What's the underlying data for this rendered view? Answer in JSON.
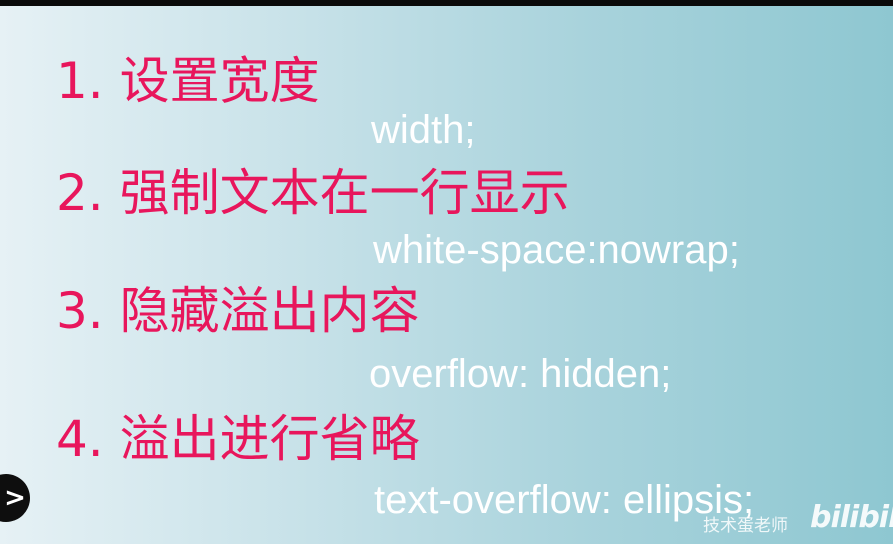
{
  "slide": {
    "steps": [
      {
        "heading": "1. 设置宽度",
        "code": "width;"
      },
      {
        "heading": "2. 强制文本在一行显示",
        "code": "white-space:nowrap;"
      },
      {
        "heading": "3. 隐藏溢出内容",
        "code": "overflow: hidden;"
      },
      {
        "heading": "4. 溢出进行省略",
        "code": "text-overflow: ellipsis;"
      }
    ]
  },
  "player": {
    "play_glyph": ">"
  },
  "watermark": {
    "author": "技术蛋老师",
    "logo": "bilibili"
  },
  "colors": {
    "heading": "#e8165c",
    "code": "#ffffff",
    "background_left": "#e6f1f5",
    "background_right": "#8ec7d1"
  }
}
